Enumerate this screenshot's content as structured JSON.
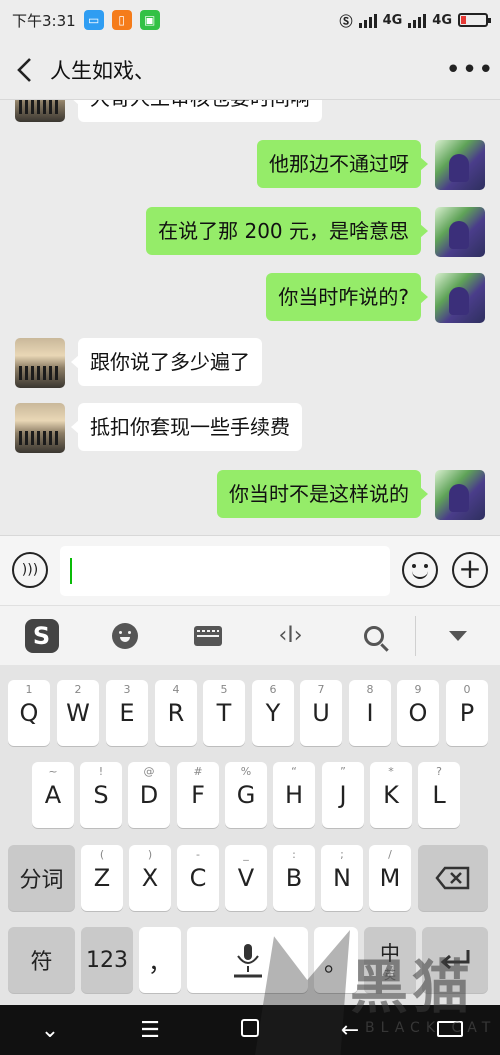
{
  "status_bar": {
    "time": "下午3:31",
    "network_1": "4G",
    "network_2": "4G"
  },
  "header": {
    "title": "人生如戏、"
  },
  "messages": [
    {
      "side": "left",
      "text": "大哥人工审核也要时间啊"
    },
    {
      "side": "right",
      "text": "他那边不通过呀"
    },
    {
      "side": "right",
      "text": "在说了那 200 元，是啥意思"
    },
    {
      "side": "right",
      "text": "你当时咋说的?"
    },
    {
      "side": "left",
      "text": "跟你说了多少遍了"
    },
    {
      "side": "left",
      "text": "抵扣你套现一些手续费"
    },
    {
      "side": "right",
      "text": "你当时不是这样说的"
    }
  ],
  "input_bar": {
    "value": ""
  },
  "keyboard_toolbar": {
    "icons": [
      "sogou-logo-icon",
      "emoji-face-icon",
      "keyboard-icon",
      "cursor-move-icon",
      "search-icon",
      "collapse-icon"
    ]
  },
  "keyboard": {
    "row1": [
      {
        "main": "Q",
        "sub": "1"
      },
      {
        "main": "W",
        "sub": "2"
      },
      {
        "main": "E",
        "sub": "3"
      },
      {
        "main": "R",
        "sub": "4"
      },
      {
        "main": "T",
        "sub": "5"
      },
      {
        "main": "Y",
        "sub": "6"
      },
      {
        "main": "U",
        "sub": "7"
      },
      {
        "main": "I",
        "sub": "8"
      },
      {
        "main": "O",
        "sub": "9"
      },
      {
        "main": "P",
        "sub": "0"
      }
    ],
    "row2": [
      {
        "main": "A",
        "sub": "~"
      },
      {
        "main": "S",
        "sub": "!"
      },
      {
        "main": "D",
        "sub": "@"
      },
      {
        "main": "F",
        "sub": "#"
      },
      {
        "main": "G",
        "sub": "%"
      },
      {
        "main": "H",
        "sub": "“"
      },
      {
        "main": "J",
        "sub": "”"
      },
      {
        "main": "K",
        "sub": "*"
      },
      {
        "main": "L",
        "sub": "?"
      }
    ],
    "row3": [
      {
        "main": "Z",
        "sub": "("
      },
      {
        "main": "X",
        "sub": ")"
      },
      {
        "main": "C",
        "sub": "-"
      },
      {
        "main": "V",
        "sub": "_"
      },
      {
        "main": "B",
        "sub": ":"
      },
      {
        "main": "N",
        "sub": ";"
      },
      {
        "main": "M",
        "sub": "/"
      }
    ],
    "fenci": "分词",
    "symbol": "符",
    "numbers": "123",
    "comma": "，",
    "lang": "中",
    "lang_sub": "英"
  },
  "watermark": {
    "text": "黑猫",
    "sub": "BLACK CAT"
  },
  "colors": {
    "bubble_right": "#95ec69",
    "bubble_left": "#ffffff",
    "chat_bg": "#ebebeb",
    "caret": "#09bb07"
  }
}
